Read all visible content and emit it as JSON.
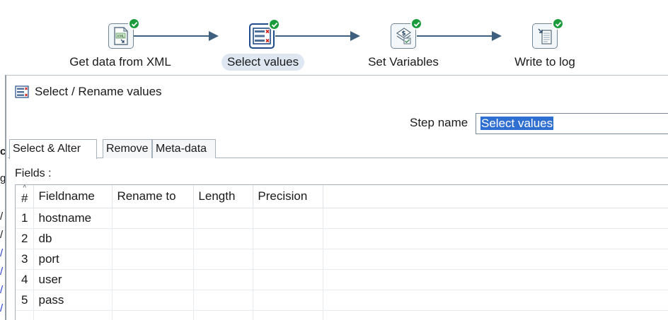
{
  "flow": {
    "steps": [
      {
        "label": "Get data from XML",
        "icon": "xml-input-icon"
      },
      {
        "label": "Select values",
        "icon": "select-values-icon",
        "active": true
      },
      {
        "label": "Set Variables",
        "icon": "set-variables-icon"
      },
      {
        "label": "Write to log",
        "icon": "write-to-log-icon"
      }
    ],
    "hop_color": "#3f5f7f",
    "check_color": "#1a9c3c"
  },
  "dialog": {
    "title": "Select / Rename values",
    "step_name_label": "Step name",
    "step_name_value": "Select values",
    "tabs": [
      "Select & Alter",
      "Remove",
      "Meta-data"
    ],
    "fields_label": "Fields :",
    "columns": [
      "#",
      "Fieldname",
      "Rename to",
      "Length",
      "Precision"
    ],
    "rows": [
      {
        "num": "1",
        "fieldname": "hostname",
        "rename": "",
        "length": "",
        "precision": ""
      },
      {
        "num": "2",
        "fieldname": "db",
        "rename": "",
        "length": "",
        "precision": ""
      },
      {
        "num": "3",
        "fieldname": "port",
        "rename": "",
        "length": "",
        "precision": ""
      },
      {
        "num": "4",
        "fieldname": "user",
        "rename": "",
        "length": "",
        "precision": ""
      },
      {
        "num": "5",
        "fieldname": "pass",
        "rename": "",
        "length": "",
        "precision": ""
      }
    ],
    "selection_color": "#2f6fd1"
  }
}
